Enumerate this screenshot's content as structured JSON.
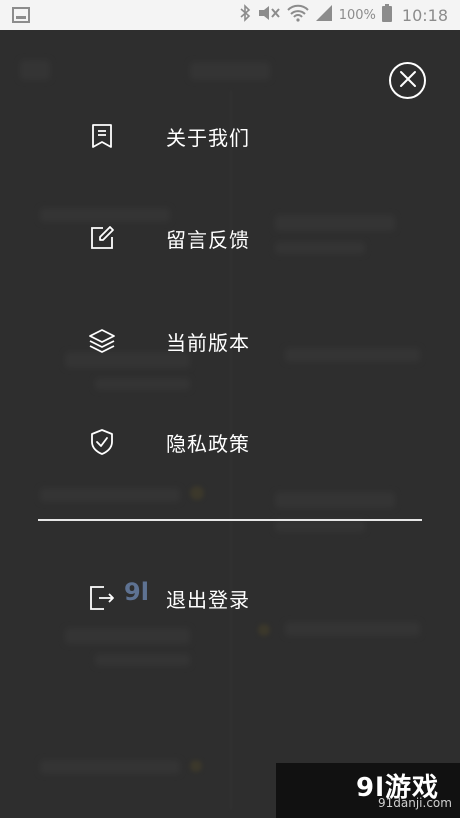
{
  "status_bar": {
    "battery": "100%",
    "time": "10:18",
    "icons": [
      "image-icon",
      "bluetooth-icon",
      "mute-icon",
      "wifi-icon",
      "signal-icon",
      "battery-icon"
    ]
  },
  "menu": {
    "close_icon": "close-icon",
    "items": [
      {
        "label": "关于我们",
        "icon": "about-icon"
      },
      {
        "label": "留言反馈",
        "icon": "feedback-icon"
      },
      {
        "label": "当前版本",
        "icon": "layers-icon"
      },
      {
        "label": "隐私政策",
        "icon": "shield-check-icon"
      }
    ],
    "logout": {
      "label": "退出登录",
      "icon": "logout-icon"
    }
  },
  "watermark": {
    "logo_text": "9l游戏",
    "url": "91danji.com"
  },
  "colors": {
    "overlay_text": "#ffffff",
    "status_bar_bg": "#f4f4f4",
    "background": "#3a3a3a",
    "divider": "#e6e6e6"
  }
}
